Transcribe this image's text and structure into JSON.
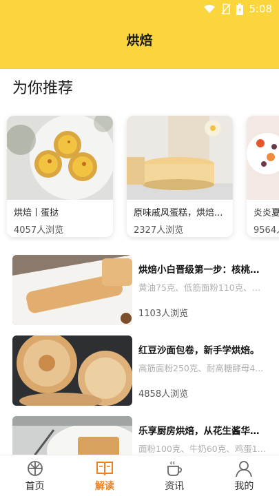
{
  "status": {
    "time": "5:08"
  },
  "header": {
    "title": "烘焙"
  },
  "section": {
    "title": "为你推荐"
  },
  "cards": [
    {
      "title": "烘焙丨蛋挞",
      "views": "4057人浏览",
      "image_icon": "egg-tart-photo"
    },
    {
      "title": "原味戚风蛋糕，烘焙...",
      "views": "2327人浏览",
      "image_icon": "chiffon-cake-photo"
    },
    {
      "title": "炎炎夏",
      "views": "9564人",
      "image_icon": "summer-dessert-photo"
    }
  ],
  "list": [
    {
      "title": "烘焙小白晋级第一步：核桃黄...",
      "subtitle": "黄油75克、低筋面粉110克、核...",
      "views": "1103人浏览",
      "image_icon": "walnut-biscotti-photo"
    },
    {
      "title": "红豆沙面包卷，新手学烘焙。",
      "subtitle": "高筋面粉250克、耐高糖酵母4...",
      "views": "4858人浏览",
      "image_icon": "red-bean-bread-photo"
    },
    {
      "title": "乐享厨房烘焙，从花生酱华夫...",
      "subtitle": "面粉100克、牛奶60克、鸡蛋1...",
      "views": "",
      "image_icon": "waffle-photo"
    }
  ],
  "nav": [
    {
      "label": "首页",
      "icon": "home-icon",
      "active": false
    },
    {
      "label": "解读",
      "icon": "book-icon",
      "active": true
    },
    {
      "label": "资讯",
      "icon": "coffee-icon",
      "active": false
    },
    {
      "label": "我的",
      "icon": "profile-icon",
      "active": false
    }
  ],
  "colors": {
    "header": "#fbd53c",
    "accent": "#f0801c"
  }
}
